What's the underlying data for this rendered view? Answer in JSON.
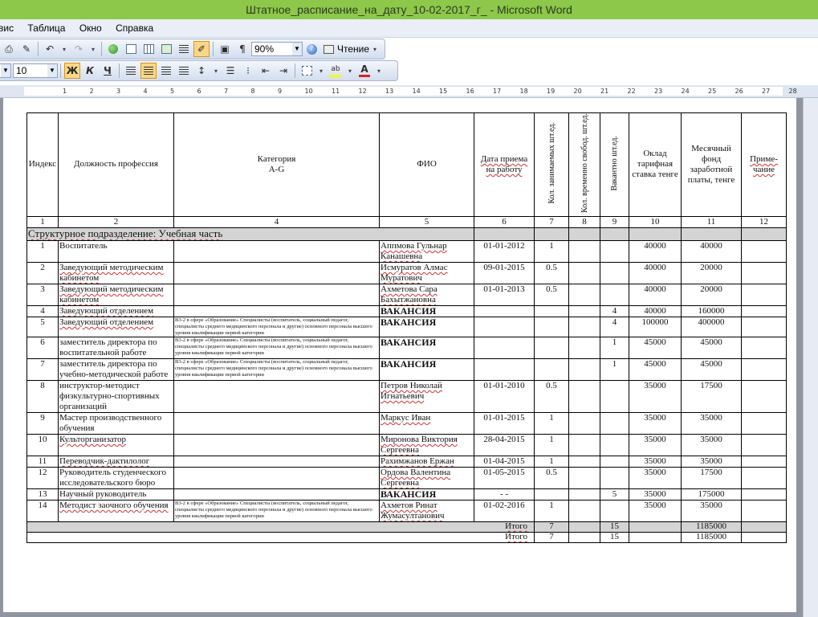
{
  "window": {
    "title": "Штатное_расписание_на_дату_10-02-2017_г_ - Microsoft Word"
  },
  "menu": [
    "вис",
    "Таблица",
    "Окно",
    "Справка"
  ],
  "toolbar": {
    "zoom": "90%",
    "reading_label": "Чтение",
    "font_size": "10",
    "bold": "Ж",
    "italic": "К",
    "underline": "Ч",
    "para_mark": "¶"
  },
  "ruler": {
    "marks": [
      "1",
      "2",
      "3",
      "4",
      "5",
      "6",
      "7",
      "8",
      "9",
      "10",
      "11",
      "12",
      "13",
      "14",
      "15",
      "16",
      "17",
      "18",
      "19",
      "20",
      "21",
      "22",
      "23",
      "24",
      "25",
      "26",
      "27",
      "28"
    ]
  },
  "table": {
    "headers": {
      "index": "Индекс",
      "position": "Должность профессия",
      "category": "Категория\nA-G",
      "fio": "ФИО",
      "date": "Дата приема на работу",
      "units_occupied": "Кол. занимаемых шт.ед.",
      "units_temp_free": "Кол. временно свобод. шт.ед.",
      "vacancy": "Вакантно шт.ед.",
      "salary": "Оклад тарифная ставка тенге",
      "monthly_fund": "Месячный фонд заработной платы, тенге",
      "note": "Приме-чание"
    },
    "col_numbers": [
      "1",
      "2",
      "4",
      "5",
      "6",
      "7",
      "8",
      "9",
      "10",
      "11",
      "12"
    ],
    "section": "Структурное подразделение: Учебная часть",
    "rows": [
      {
        "idx": "1",
        "pos": "Воспитатель",
        "cat": "",
        "fio": "Аппмова Гульнар Канашевна",
        "date": "01-01-2012",
        "occ": "1",
        "tmp": "",
        "vac": "",
        "sal": "40000",
        "fund": "40000",
        "note": ""
      },
      {
        "idx": "2",
        "pos": "Заведующий методическим кабинетом",
        "cat": "",
        "fio": "Исмуратов Алмас Муратович",
        "date": "09-01-2015",
        "occ": "0.5",
        "tmp": "",
        "vac": "",
        "sal": "40000",
        "fund": "20000",
        "note": ""
      },
      {
        "idx": "3",
        "pos": "Заведующий методическим кабинетом",
        "cat": "",
        "fio": "Ахметова Сара Бахытжановна",
        "date": "01-01-2013",
        "occ": "0.5",
        "tmp": "",
        "vac": "",
        "sal": "40000",
        "fund": "20000",
        "note": ""
      },
      {
        "idx": "4",
        "pos": "Заведующий отделением",
        "cat": "",
        "fio": "ВАКАНСИЯ",
        "date": "",
        "occ": "",
        "tmp": "",
        "vac": "4",
        "sal": "40000",
        "fund": "160000",
        "note": ""
      },
      {
        "idx": "5",
        "pos": "Заведующий отделением",
        "cat": "В3-2 в сфере «Образование» Специалисты (воспитатель, социальный педагог, специалисты среднего медицинского персонала и другие) основного персонала высшего уровня квалификации первой категории",
        "fio": "ВАКАНСИЯ",
        "date": "",
        "occ": "",
        "tmp": "",
        "vac": "4",
        "sal": "100000",
        "fund": "400000",
        "note": ""
      },
      {
        "idx": "6",
        "pos": "заместитель директора по воспитательной работе",
        "cat": "В3-2 в сфере «Образование» Специалисты (воспитатель, социальный педагог, специалисты среднего медицинского персонала и другие) основного персонала высшего уровня квалификации первой категории",
        "fio": "ВАКАНСИЯ",
        "date": "",
        "occ": "",
        "tmp": "",
        "vac": "1",
        "sal": "45000",
        "fund": "45000",
        "note": ""
      },
      {
        "idx": "7",
        "pos": "заместитель директора по учебно-методической работе",
        "cat": "В3-2 в сфере «Образование» Специалисты (воспитатель, социальный педагог, специалисты среднего медицинского персонала и другие) основного персонала высшего уровня квалификации первой категории",
        "fio": "ВАКАНСИЯ",
        "date": "",
        "occ": "",
        "tmp": "",
        "vac": "1",
        "sal": "45000",
        "fund": "45000",
        "note": ""
      },
      {
        "idx": "8",
        "pos": "инструктор-методист физкультурно-спортивных организаций",
        "cat": "",
        "fio": "Петров Николай Игнатьевич",
        "date": "01-01-2010",
        "occ": "0.5",
        "tmp": "",
        "vac": "",
        "sal": "35000",
        "fund": "17500",
        "note": ""
      },
      {
        "idx": "9",
        "pos": "Мастер производственного обучения",
        "cat": "",
        "fio": "Маркус Иван",
        "date": "01-01-2015",
        "occ": "1",
        "tmp": "",
        "vac": "",
        "sal": "35000",
        "fund": "35000",
        "note": ""
      },
      {
        "idx": "10",
        "pos": "Культорганизатор",
        "cat": "",
        "fio": "Миронова Виктория Сергеевна",
        "date": "28-04-2015",
        "occ": "1",
        "tmp": "",
        "vac": "",
        "sal": "35000",
        "fund": "35000",
        "note": ""
      },
      {
        "idx": "11",
        "pos": "Переводчик-дактилолог",
        "cat": "",
        "fio": "Рахимжанов Ержан",
        "date": "01-04-2015",
        "occ": "1",
        "tmp": "",
        "vac": "",
        "sal": "35000",
        "fund": "35000",
        "note": ""
      },
      {
        "idx": "12",
        "pos": "Руководитель студенческого исследовательского бюро",
        "cat": "",
        "fio": "Ордова Валентина Сергеевна",
        "date": "01-05-2015",
        "occ": "0.5",
        "tmp": "",
        "vac": "",
        "sal": "35000",
        "fund": "17500",
        "note": ""
      },
      {
        "idx": "13",
        "pos": "Научный руководитель",
        "cat": "",
        "fio": "ВАКАНСИЯ",
        "date": "- -",
        "occ": "",
        "tmp": "",
        "vac": "5",
        "sal": "35000",
        "fund": "175000",
        "note": ""
      },
      {
        "idx": "14",
        "pos": "Методист заочного обучения",
        "cat": "В3-2 в сфере «Образование» Специалисты (воспитатель, социальный педагог, специалисты среднего медицинского персонала и другие) основного персонала высшего уровня квалификации первой категории",
        "fio": "Ахметов Ринат Жумасултанович",
        "date": "01-02-2016",
        "occ": "1",
        "tmp": "",
        "vac": "",
        "sal": "35000",
        "fund": "35000",
        "note": ""
      }
    ],
    "totals": [
      {
        "label": "Итого",
        "occ": "7",
        "vac": "15",
        "fund": "1185000"
      },
      {
        "label": "Итого",
        "occ": "7",
        "vac": "15",
        "fund": "1185000"
      }
    ]
  },
  "colors": {
    "titlebar": "#8dc84a",
    "section_bg": "#d4d4d4",
    "toolbar_active": "#fbd785"
  }
}
